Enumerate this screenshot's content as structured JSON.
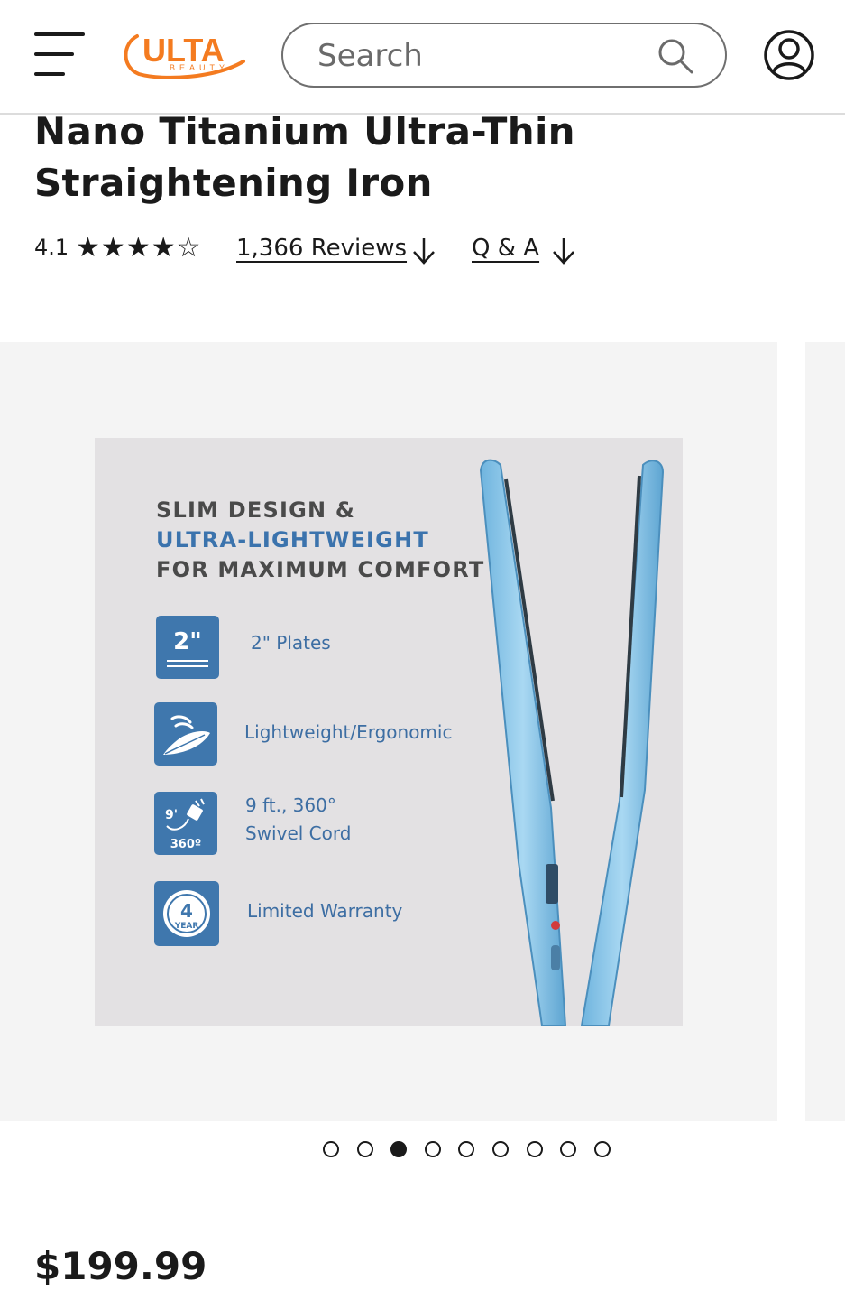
{
  "header": {
    "brand_name": "ULTA",
    "brand_sub": "BEAUTY",
    "brand_color": "#f47b20",
    "search_placeholder": "Search"
  },
  "product": {
    "title": "Nano Titanium Ultra-Thin Straightening Iron",
    "rating": "4.1",
    "stars_filled": 4,
    "stars_total": 5,
    "reviews_label": "1,366 Reviews",
    "qa_label": "Q & A",
    "price": "$199.99"
  },
  "image": {
    "headline_line1": "SLIM DESIGN &",
    "headline_line2": "ULTRA-LIGHTWEIGHT",
    "headline_line3": "FOR MAXIMUM COMFORT",
    "accent_color": "#3b73ad",
    "features": [
      {
        "badge": "2\"",
        "text": "2\" Plates"
      },
      {
        "badge": "feather",
        "text": "Lightweight/Ergonomic"
      },
      {
        "badge": "9' 360°",
        "badge_top": "9'",
        "badge_bottom": "360º",
        "text_line1": "9 ft., 360°",
        "text_line2": "Swivel Cord"
      },
      {
        "badge": "4 YEAR",
        "badge_num": "4",
        "badge_word": "YEAR",
        "text": "Limited Warranty"
      }
    ]
  },
  "carousel": {
    "total": 9,
    "active_index": 2
  }
}
